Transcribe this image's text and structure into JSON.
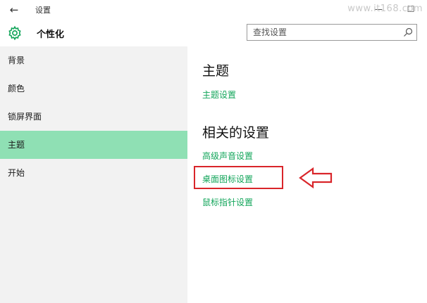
{
  "window": {
    "title": "设置",
    "back_icon": "←",
    "minimize_icon": "—",
    "maximize_icon": "☐",
    "watermark": "www.it168.com"
  },
  "header": {
    "title": "个性化",
    "gear_icon": "gear-icon",
    "search": {
      "placeholder": "查找设置",
      "value": ""
    }
  },
  "sidebar": {
    "items": [
      {
        "label": "背景",
        "active": false
      },
      {
        "label": "颜色",
        "active": false
      },
      {
        "label": "锁屏界面",
        "active": false
      },
      {
        "label": "主题",
        "active": true
      },
      {
        "label": "开始",
        "active": false
      }
    ]
  },
  "content": {
    "theme_section": {
      "title": "主题",
      "links": [
        "主题设置"
      ]
    },
    "related_section": {
      "title": "相关的设置",
      "links": [
        "高级声音设置",
        "桌面图标设置",
        "鼠标指针设置"
      ]
    }
  },
  "colors": {
    "accent": "#8fe0b4",
    "link": "#12a55a",
    "annotation": "#d9252a"
  }
}
